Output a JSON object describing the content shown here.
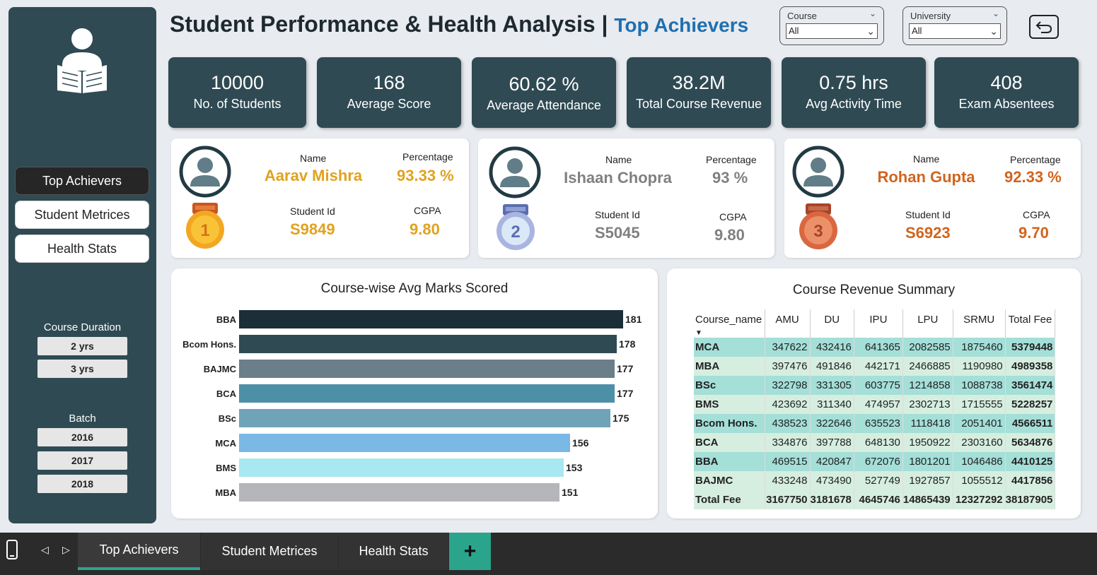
{
  "header": {
    "title": "Student Performance & Health Analysis",
    "separator": "|",
    "subtitle": "Top Achievers"
  },
  "filters": {
    "course": {
      "label": "Course",
      "value": "All"
    },
    "university": {
      "label": "University",
      "value": "All"
    }
  },
  "sidebar": {
    "nav": [
      "Top Achievers",
      "Student Metrices",
      "Health Stats"
    ],
    "active_nav": "Top Achievers",
    "duration_label": "Course Duration",
    "durations": [
      "2 yrs",
      "3 yrs"
    ],
    "batch_label": "Batch",
    "batches": [
      "2016",
      "2017",
      "2018"
    ]
  },
  "kpis": [
    {
      "value": "10000",
      "label": "No. of Students"
    },
    {
      "value": "168",
      "label": "Average Score"
    },
    {
      "value": "60.62 %",
      "label": "Average Attendance"
    },
    {
      "value": "38.2M",
      "label": "Total Course Revenue"
    },
    {
      "value": "0.75 hrs",
      "label": "Avg Activity Time"
    },
    {
      "value": "408",
      "label": "Exam Absentees"
    }
  ],
  "achievers": {
    "name_label": "Name",
    "pct_label": "Percentage",
    "id_label": "Student Id",
    "cgpa_label": "CGPA",
    "list": [
      {
        "rank": "1",
        "name": "Aarav Mishra",
        "percentage": "93.33 %",
        "student_id": "S9849",
        "cgpa": "9.80"
      },
      {
        "rank": "2",
        "name": "Ishaan Chopra",
        "percentage": "93 %",
        "student_id": "S5045",
        "cgpa": "9.80"
      },
      {
        "rank": "3",
        "name": "Rohan Gupta",
        "percentage": "92.33 %",
        "student_id": "S6923",
        "cgpa": "9.70"
      }
    ]
  },
  "chart_data": {
    "type": "bar",
    "orientation": "horizontal",
    "title": "Course-wise Avg Marks Scored",
    "categories": [
      "BBA",
      "Bcom Hons.",
      "BAJMC",
      "BCA",
      "BSc",
      "MCA",
      "BMS",
      "MBA"
    ],
    "values": [
      181,
      178,
      177,
      177,
      175,
      156,
      153,
      151
    ],
    "colors": [
      "#1c2e37",
      "#2f4a53",
      "#6b7f8a",
      "#4d8fa6",
      "#6fa4b8",
      "#7ab9e6",
      "#a8e8f0",
      "#b4b6ba"
    ],
    "xlim": [
      0,
      181
    ]
  },
  "revenue": {
    "title": "Course Revenue Summary",
    "columns": [
      "Course_name",
      "AMU",
      "DU",
      "IPU",
      "LPU",
      "SRMU",
      "Total Fee"
    ],
    "rows": [
      [
        "MCA",
        "347622",
        "432416",
        "641365",
        "2082585",
        "1875460",
        "5379448"
      ],
      [
        "MBA",
        "397476",
        "491846",
        "442171",
        "2466885",
        "1190980",
        "4989358"
      ],
      [
        "BSc",
        "322798",
        "331305",
        "603775",
        "1214858",
        "1088738",
        "3561474"
      ],
      [
        "BMS",
        "423692",
        "311340",
        "474957",
        "2302713",
        "1715555",
        "5228257"
      ],
      [
        "Bcom Hons.",
        "438523",
        "322646",
        "635523",
        "1118418",
        "2051401",
        "4566511"
      ],
      [
        "BCA",
        "334876",
        "397788",
        "648130",
        "1950922",
        "2303160",
        "5634876"
      ],
      [
        "BBA",
        "469515",
        "420847",
        "672076",
        "1801201",
        "1046486",
        "4410125"
      ],
      [
        "BAJMC",
        "433248",
        "473490",
        "527749",
        "1927857",
        "1055512",
        "4417856"
      ]
    ],
    "total": [
      "Total Fee",
      "3167750",
      "3181678",
      "4645746",
      "14865439",
      "12327292",
      "38187905"
    ]
  },
  "tabs": [
    "Top Achievers",
    "Student Metrices",
    "Health Stats"
  ],
  "add_tab": "+"
}
